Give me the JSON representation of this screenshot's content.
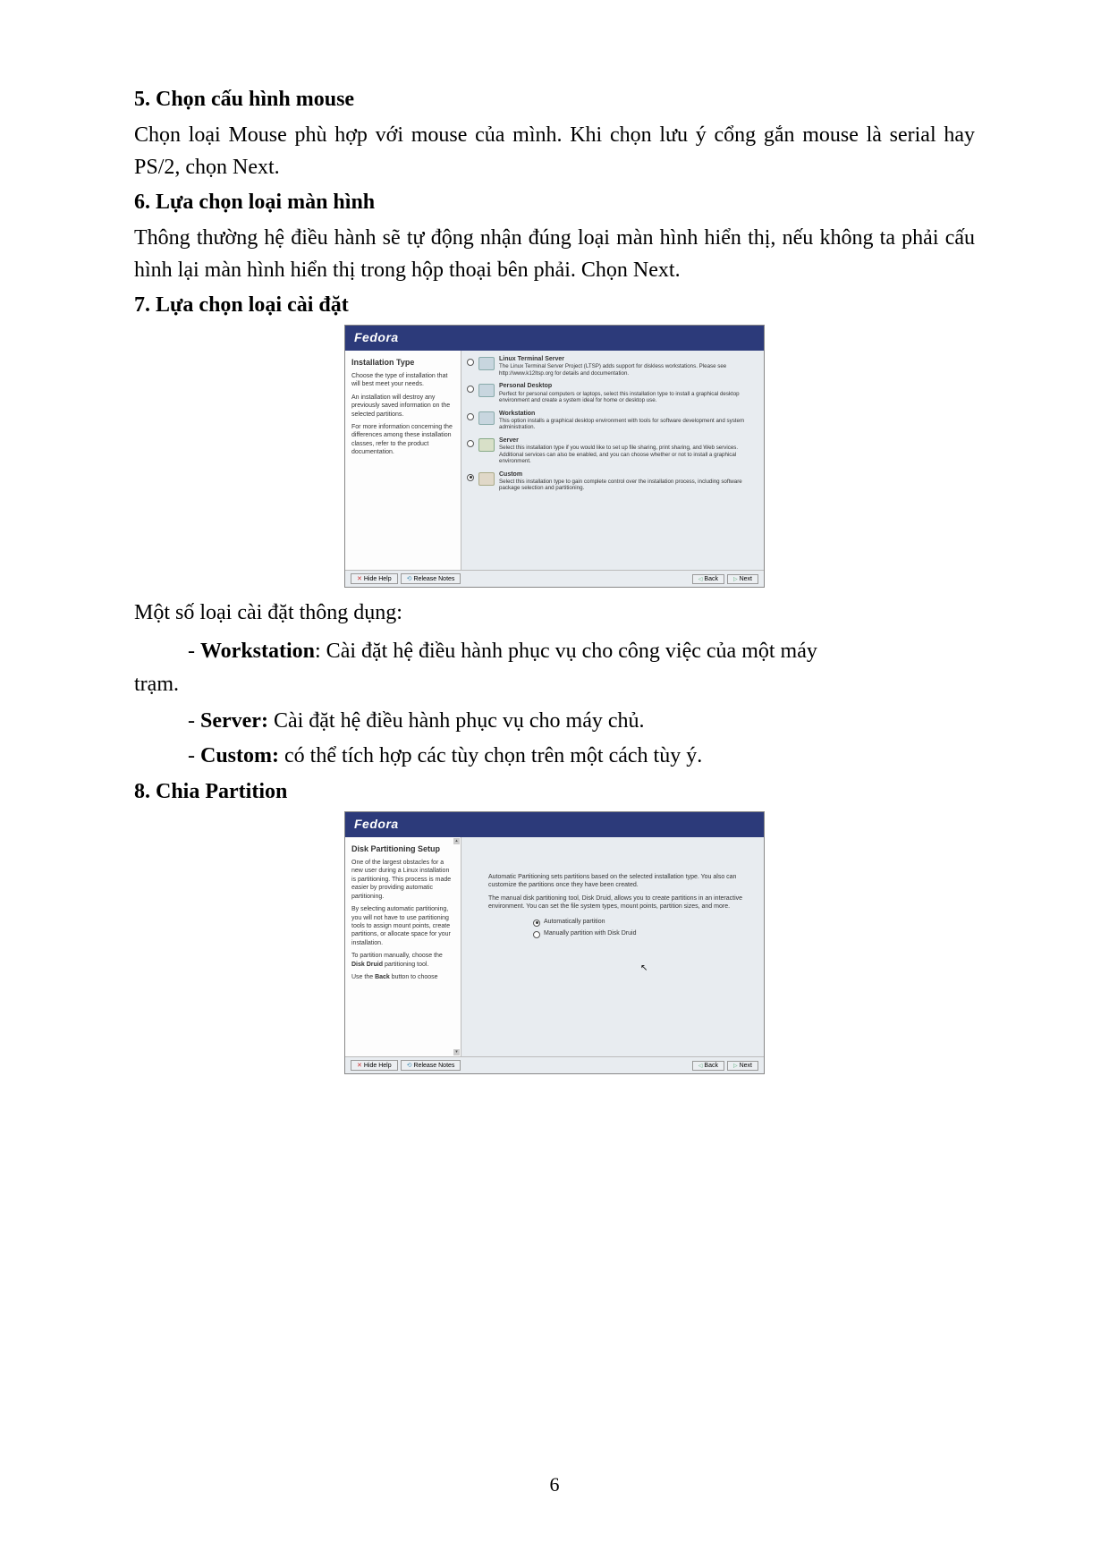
{
  "sections": {
    "s5": {
      "heading": "5. Chọn cấu hình mouse",
      "para": "Chọn loại Mouse phù hợp với mouse của mình. Khi chọn lưu ý cổng gắn mouse là serial hay PS/2, chọn Next."
    },
    "s6": {
      "heading": "6. Lựa chọn loại màn hình",
      "para": "Thông thường hệ điều hành sẽ tự động nhận đúng loại màn hình hiển thị, nếu không ta phải cấu hình lại màn hình hiển thị trong hộp thoại bên phải. Chọn Next."
    },
    "s7": {
      "heading": "7. Lựa chọn loại cài đặt",
      "after_image": "Một số loại cài đặt thông dụng:",
      "bullets": {
        "workstation_label": "Workstation",
        "workstation_text": ": Cài đặt hệ điều hành phục vụ cho công việc của một máy ",
        "workstation_tail": "trạm.",
        "server_label": "Server:",
        "server_text": " Cài đặt hệ điều hành phục vụ cho máy chủ.",
        "custom_label": "Custom:",
        "custom_text": " có thể tích hợp các tùy chọn trên một cách tùy ý."
      }
    },
    "s8": {
      "heading": "8. Chia Partition"
    }
  },
  "fedora_brand": "Fedora",
  "installer1": {
    "left_title": "Installation Type",
    "left_p1": "Choose the type of installation that will best meet your needs.",
    "left_p2": "An installation will destroy any previously saved information on the selected partitions.",
    "left_p3": "For more information concerning the differences among these installation classes, refer to the product documentation.",
    "options": [
      {
        "title": "Linux Terminal Server",
        "desc": "The Linux Terminal Server Project (LTSP) adds support for diskless workstations. Please see http://www.k12ltsp.org for details and documentation."
      },
      {
        "title": "Personal Desktop",
        "desc": "Perfect for personal computers or laptops, select this installation type to install a graphical desktop environment and create a system ideal for home or desktop use."
      },
      {
        "title": "Workstation",
        "desc": "This option installs a graphical desktop environment with tools for software development and system administration."
      },
      {
        "title": "Server",
        "desc": "Select this installation type if you would like to set up file sharing, print sharing, and Web services. Additional services can also be enabled, and you can choose whether or not to install a graphical environment."
      },
      {
        "title": "Custom",
        "desc": "Select this installation type to gain complete control over the installation process, including software package selection and partitioning."
      }
    ]
  },
  "installer2": {
    "left_title": "Disk Partitioning Setup",
    "left_p1": "One of the largest obstacles for a new user during a Linux installation is partitioning. This process is made easier by providing automatic partitioning.",
    "left_p2": "By selecting automatic partitioning, you will not have to use partitioning tools to assign mount points, create partitions, or allocate space for your installation.",
    "left_p3": "To partition manually, choose the Disk Druid partitioning tool.",
    "left_p4": "Use the Back button to choose",
    "right_p1": "Automatic Partitioning sets partitions based on the selected installation type. You also can customize the partitions once they have been created.",
    "right_p2": "The manual disk partitioning tool, Disk Druid, allows you to create partitions in an interactive environment. You can set the file system types, mount points, partition sizes, and more.",
    "radio1": "Automatically partition",
    "radio2": "Manually partition with Disk Druid"
  },
  "footer_buttons": {
    "hide_help": "Hide Help",
    "release_notes": "Release Notes",
    "back": "Back",
    "next": "Next"
  },
  "page_number": "6"
}
